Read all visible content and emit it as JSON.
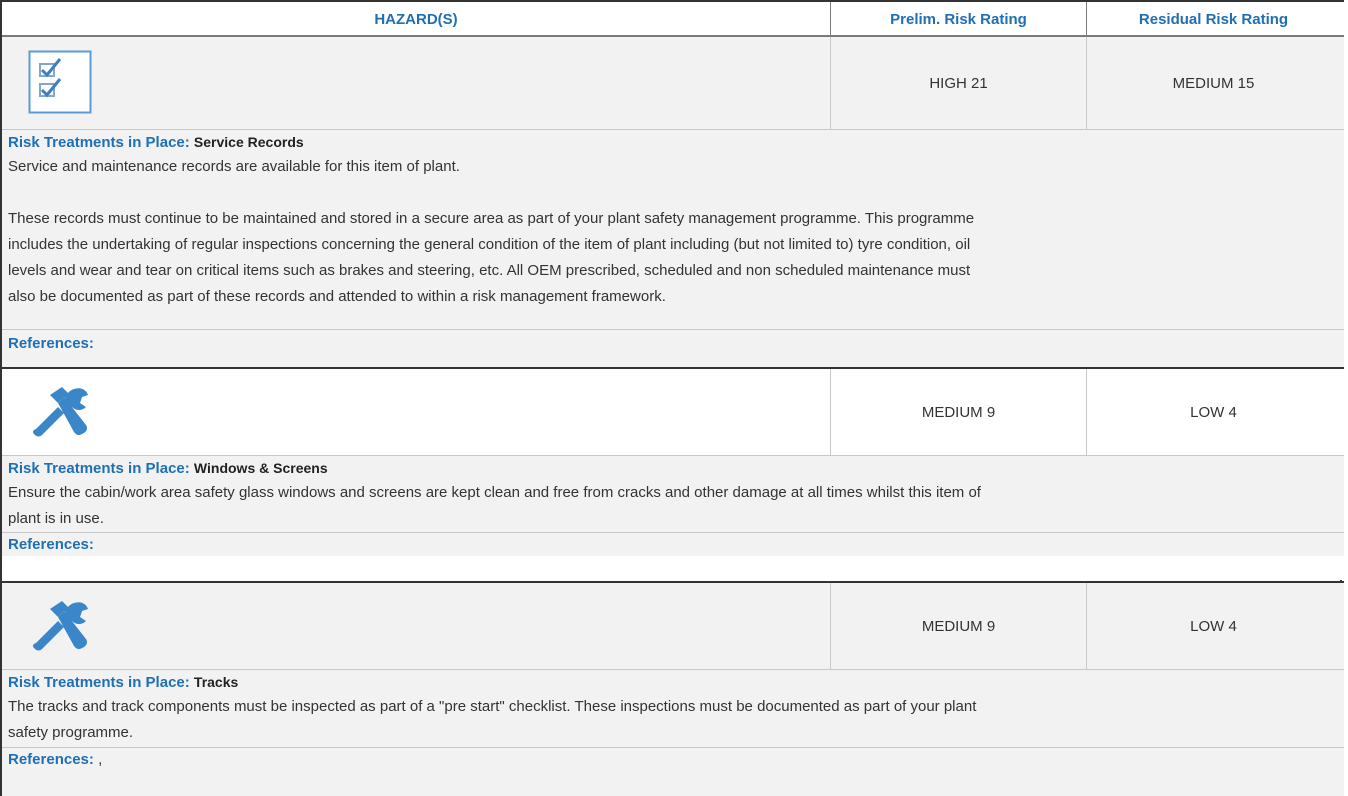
{
  "header": {
    "hazards": "HAZARD(S)",
    "prelim": "Prelim. Risk Rating",
    "residual": "Residual Risk Rating"
  },
  "rows": [
    {
      "icon": "checklist-icon",
      "prelim": "HIGH 21",
      "residual": "MEDIUM 15",
      "treatments_label": "Risk Treatments in Place:",
      "treatment_title": "Service Records",
      "para1": "Service and maintenance records are available for this item of plant.",
      "para2_l1": "These records must continue to be maintained and stored in a secure area as part of your plant safety management programme. This programme",
      "para2_l2": "includes the undertaking of regular inspections concerning the general condition of the item of plant including (but not limited to) tyre condition, oil",
      "para2_l3": "levels and wear and tear on critical items such as brakes and steering, etc. All OEM prescribed, scheduled and non scheduled maintenance must",
      "para2_l4": "also be documented as part of these records and attended to within a risk management framework.",
      "references_label": "References:",
      "references_value": ""
    },
    {
      "icon": "tools-icon",
      "prelim": "MEDIUM 9",
      "residual": "LOW 4",
      "treatments_label": "Risk Treatments in Place:",
      "treatment_title": "Windows & Screens",
      "para1_l1": "Ensure the cabin/work area safety glass windows and screens are kept clean and free from cracks and other damage at all times whilst this item of",
      "para1_l2": "plant is in use.",
      "references_label": "References:",
      "references_value": ""
    },
    {
      "icon": "tools-icon",
      "prelim": "MEDIUM 9",
      "residual": "LOW 4",
      "treatments_label": "Risk Treatments in Place:",
      "treatment_title": "Tracks",
      "para1_l1": "The tracks and track components must be inspected as part of a \"pre start\" checklist. These inspections must be documented as part of your plant",
      "para1_l2": "safety programme.",
      "references_label": "References:",
      "references_value": ","
    }
  ],
  "colors": {
    "accent": "#1f6fb5",
    "row_grey": "#f2f2f2",
    "border": "#333333"
  }
}
